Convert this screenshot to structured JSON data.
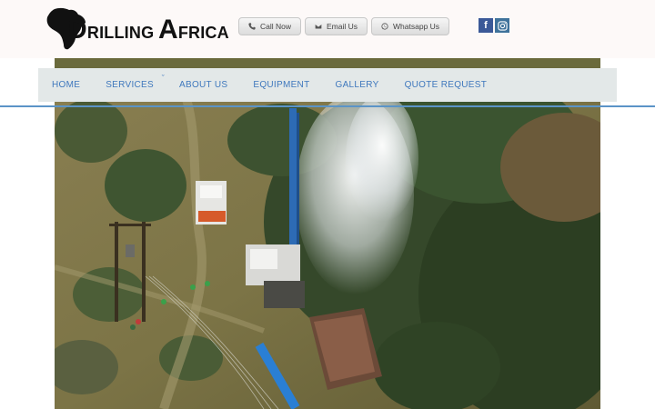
{
  "brand": {
    "logo_first_letter": "D",
    "logo_word1_rest": "RILLING",
    "logo_word2_first": "A",
    "logo_word2_rest": "FRICA"
  },
  "contact_buttons": [
    {
      "label": "Call Now",
      "icon": "phone-icon"
    },
    {
      "label": "Email Us",
      "icon": "envelope-icon"
    },
    {
      "label": "Whatsapp Us",
      "icon": "whatsapp-icon"
    }
  ],
  "social": [
    {
      "name": "facebook-icon",
      "glyph": "f",
      "color": "#3b5998"
    },
    {
      "name": "instagram-icon",
      "color": "#3f729b"
    }
  ],
  "nav": {
    "items": [
      {
        "label": "HOME"
      },
      {
        "label": "SERVICES",
        "has_dropdown": true
      },
      {
        "label": "ABOUT US"
      },
      {
        "label": "EQUIPMENT"
      },
      {
        "label": "GALLERY"
      },
      {
        "label": "QUOTE REQUEST"
      }
    ],
    "chevron": "ˇ"
  },
  "colors": {
    "nav_text": "#3f78bd",
    "nav_bg": "#e3e8e8",
    "accent_line": "#5b94c7",
    "top_bg": "#fdf9f8"
  }
}
